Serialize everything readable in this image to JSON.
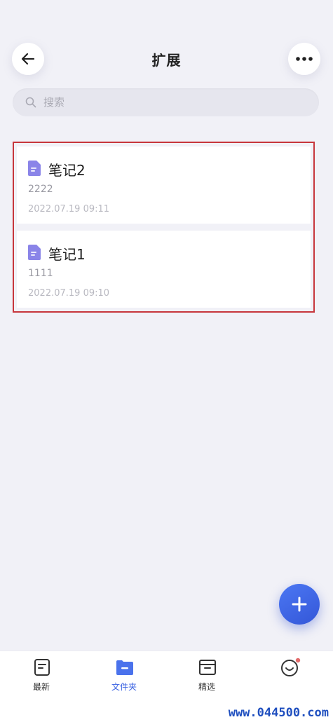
{
  "header": {
    "title": "扩展",
    "back_icon": "arrow-left-icon",
    "more_icon": "more-horizontal-icon"
  },
  "search": {
    "placeholder": "搜索",
    "icon": "search-icon"
  },
  "notes": [
    {
      "title": "笔记2",
      "preview": "2222",
      "date": "2022.07.19 09:11",
      "icon": "note-doc-icon"
    },
    {
      "title": "笔记1",
      "preview": "1111",
      "date": "2022.07.19 09:10",
      "icon": "note-doc-icon"
    }
  ],
  "fab": {
    "icon": "plus-icon"
  },
  "tabs": [
    {
      "label": "最新",
      "icon": "latest-doc-icon",
      "active": false
    },
    {
      "label": "文件夹",
      "icon": "folder-icon",
      "active": true
    },
    {
      "label": "精选",
      "icon": "archive-box-icon",
      "active": false
    },
    {
      "label": "",
      "icon": "smiley-face-icon",
      "active": false,
      "badge": true
    }
  ],
  "watermark": "www.044500.com",
  "colors": {
    "accent": "#3a62e2",
    "note_icon": "#8a84e8",
    "highlight_border": "#c7363c",
    "badge": "#e26a6a",
    "background": "#f1f1f7"
  }
}
